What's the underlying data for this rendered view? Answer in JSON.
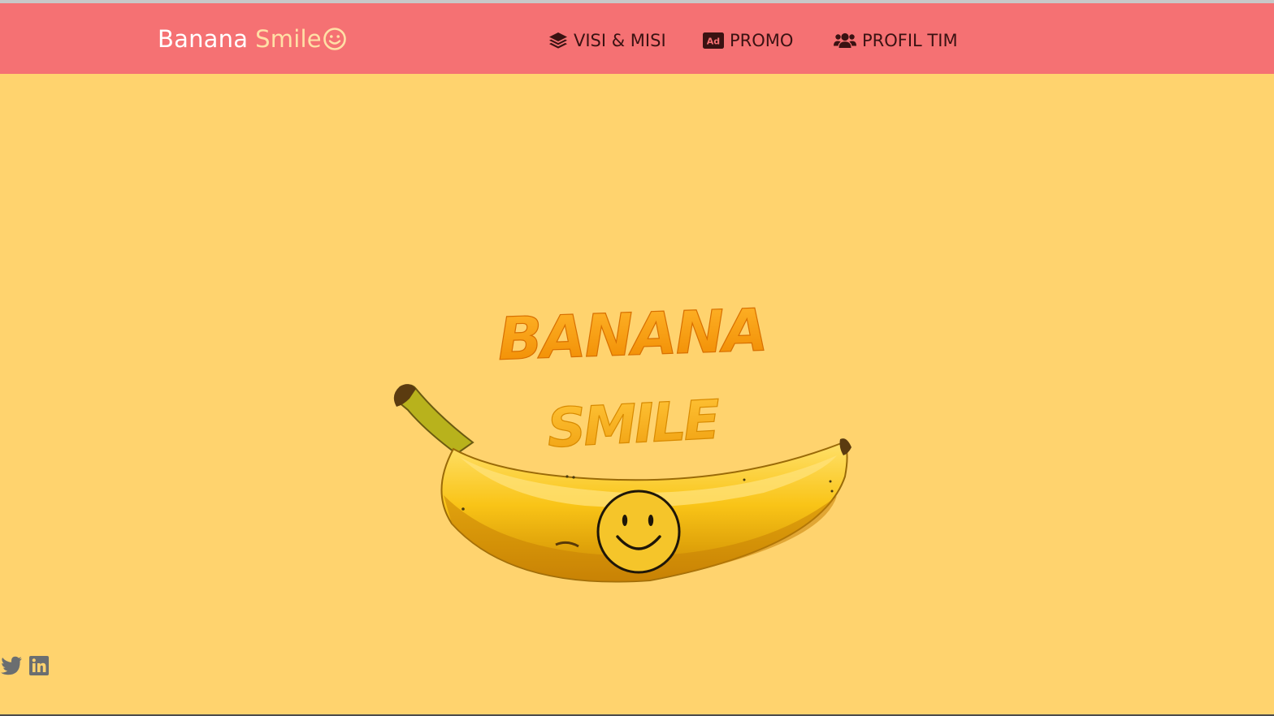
{
  "brand": {
    "word1": "Banana",
    "word2": "Smile",
    "icon": "smile-icon"
  },
  "nav": {
    "items": [
      {
        "label": "VISI & MISI",
        "icon": "layers-icon"
      },
      {
        "label": "PROMO",
        "icon": "ad-icon"
      },
      {
        "label": "PROFIL TIM",
        "icon": "users-icon"
      }
    ]
  },
  "hero": {
    "logo_line1": "BANANA",
    "logo_line2": "SMILE"
  },
  "social": [
    {
      "icon": "twitter-icon"
    },
    {
      "icon": "linkedin-icon"
    }
  ],
  "colors": {
    "navbar": "#f57173",
    "background": "#ffd36e",
    "brand_accent": "#ffe0a6",
    "nav_text": "#3a1212"
  }
}
